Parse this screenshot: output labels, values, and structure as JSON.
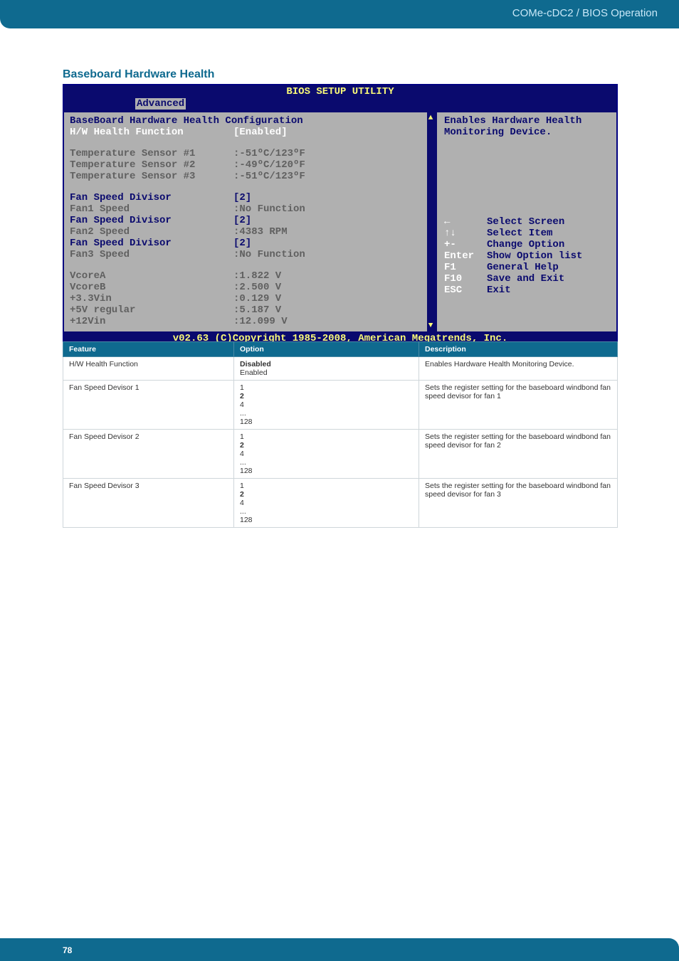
{
  "header": {
    "breadcrumb": "COMe-cDC2 / BIOS Operation"
  },
  "section": {
    "title": "Baseboard Hardware Health"
  },
  "bios": {
    "title": "BIOS SETUP UTILITY",
    "active_tab": "Advanced",
    "header_line": "BaseBoard Hardware Health Configuration",
    "rows": [
      {
        "label": "H/W Health Function",
        "value": "[Enabled]",
        "style": "selected"
      },
      {
        "label": "",
        "value": "",
        "style": "blank"
      },
      {
        "label": "Temperature Sensor #1",
        "value": ":-51ºC/123ºF",
        "style": "gray"
      },
      {
        "label": "Temperature Sensor #2",
        "value": ":-49ºC/120ºF",
        "style": "gray"
      },
      {
        "label": "Temperature Sensor #3",
        "value": ":-51ºC/123ºF",
        "style": "gray"
      },
      {
        "label": "",
        "value": "",
        "style": "blank"
      },
      {
        "label": "Fan Speed Divisor",
        "value": "[2]",
        "style": "normal"
      },
      {
        "label": "Fan1 Speed",
        "value": ":No Function",
        "style": "gray"
      },
      {
        "label": "Fan Speed Divisor",
        "value": "[2]",
        "style": "normal"
      },
      {
        "label": "Fan2 Speed",
        "value": ":4383 RPM",
        "style": "gray"
      },
      {
        "label": "Fan Speed Divisor",
        "value": "[2]",
        "style": "normal"
      },
      {
        "label": "Fan3 Speed",
        "value": ":No Function",
        "style": "gray"
      },
      {
        "label": "",
        "value": "",
        "style": "blank"
      },
      {
        "label": "VcoreA",
        "value": ":1.822 V",
        "style": "gray"
      },
      {
        "label": "VcoreB",
        "value": ":2.500 V",
        "style": "gray"
      },
      {
        "label": "+3.3Vin",
        "value": ":0.129 V",
        "style": "gray"
      },
      {
        "label": "+5V regular",
        "value": ":5.187 V",
        "style": "gray"
      },
      {
        "label": "+12Vin",
        "value": ":12.099 V",
        "style": "gray"
      }
    ],
    "help_text": "Enables Hardware Health Monitoring Device.",
    "nav": [
      {
        "key": "←",
        "text": "Select Screen"
      },
      {
        "key": "↑↓",
        "text": "Select Item"
      },
      {
        "key": "+-",
        "text": "Change Option"
      },
      {
        "key": "Enter",
        "text": "Show Option list"
      },
      {
        "key": "F1",
        "text": "General Help"
      },
      {
        "key": "F10",
        "text": "Save and Exit"
      },
      {
        "key": "ESC",
        "text": "Exit"
      }
    ],
    "footer": "v02.63 (C)Copyright 1985-2008, American Megatrends, Inc."
  },
  "table": {
    "headers": {
      "feature": "Feature",
      "option": "Option",
      "description": "Description"
    },
    "rows": [
      {
        "feature": "H/W Health Function",
        "options": [
          "Disabled",
          "Enabled"
        ],
        "default": "Disabled",
        "description": "Enables Hardware Health Monitoring Device."
      },
      {
        "feature": "Fan Speed Devisor 1",
        "options": [
          "1",
          "2",
          "4",
          "...",
          "128"
        ],
        "default": "2",
        "description": "Sets the register setting for the baseboard windbond fan speed devisor for fan 1"
      },
      {
        "feature": "Fan Speed Devisor 2",
        "options": [
          "1",
          "2",
          "4",
          "...",
          "128"
        ],
        "default": "2",
        "description": "Sets the register setting for the baseboard windbond fan speed devisor for fan 2"
      },
      {
        "feature": "Fan Speed Devisor 3",
        "options": [
          "1",
          "2",
          "4",
          "...",
          "128"
        ],
        "default": "2",
        "description": "Sets the register setting for the baseboard windbond fan speed devisor for fan 3"
      }
    ]
  },
  "page": {
    "number": "78"
  }
}
